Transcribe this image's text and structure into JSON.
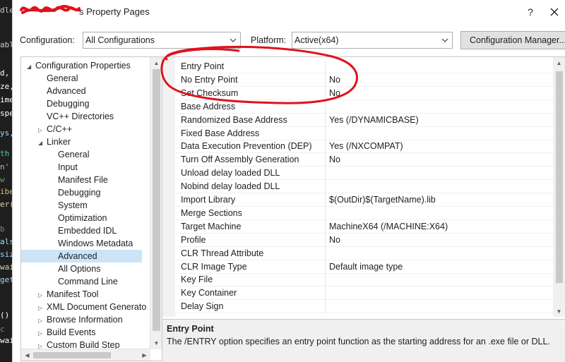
{
  "code_strip": {
    "lines": [
      "dle",
      "abl",
      "d,",
      "ze,",
      "ime",
      "spe",
      "ys,",
      "th",
      "n'",
      "w",
      "ibe",
      "er(",
      "b",
      "als",
      "siz",
      "wai",
      "get",
      "()",
      "c",
      "wai"
    ],
    "color_code": "#dcdcdc"
  },
  "window": {
    "title": "s Property Pages",
    "help_label": "?",
    "close_icon": "close-icon",
    "redaction_color": "#e0121b"
  },
  "toolbar": {
    "configuration_label": "Configuration:",
    "configuration_value": "All Configurations",
    "platform_label": "Platform:",
    "platform_value": "Active(x64)",
    "config_manager_label": "Configuration Manager..."
  },
  "tree": {
    "items": [
      {
        "label": "Configuration Properties",
        "level": 0,
        "expander": "open"
      },
      {
        "label": "General",
        "level": 1,
        "expander": ""
      },
      {
        "label": "Advanced",
        "level": 1,
        "expander": ""
      },
      {
        "label": "Debugging",
        "level": 1,
        "expander": ""
      },
      {
        "label": "VC++ Directories",
        "level": 1,
        "expander": ""
      },
      {
        "label": "C/C++",
        "level": 1,
        "expander": "closed"
      },
      {
        "label": "Linker",
        "level": 1,
        "expander": "open"
      },
      {
        "label": "General",
        "level": 2,
        "expander": ""
      },
      {
        "label": "Input",
        "level": 2,
        "expander": ""
      },
      {
        "label": "Manifest File",
        "level": 2,
        "expander": ""
      },
      {
        "label": "Debugging",
        "level": 2,
        "expander": ""
      },
      {
        "label": "System",
        "level": 2,
        "expander": ""
      },
      {
        "label": "Optimization",
        "level": 2,
        "expander": ""
      },
      {
        "label": "Embedded IDL",
        "level": 2,
        "expander": ""
      },
      {
        "label": "Windows Metadata",
        "level": 2,
        "expander": ""
      },
      {
        "label": "Advanced",
        "level": 2,
        "expander": "",
        "selected": true
      },
      {
        "label": "All Options",
        "level": 2,
        "expander": ""
      },
      {
        "label": "Command Line",
        "level": 2,
        "expander": ""
      },
      {
        "label": "Manifest Tool",
        "level": 1,
        "expander": "closed"
      },
      {
        "label": "XML Document Generato",
        "level": 1,
        "expander": "closed"
      },
      {
        "label": "Browse Information",
        "level": 1,
        "expander": "closed"
      },
      {
        "label": "Build Events",
        "level": 1,
        "expander": "closed"
      },
      {
        "label": "Custom Build Step",
        "level": 1,
        "expander": "closed"
      }
    ]
  },
  "grid": {
    "rows": [
      {
        "name": "Entry Point",
        "value": ""
      },
      {
        "name": "No Entry Point",
        "value": "No"
      },
      {
        "name": "Set Checksum",
        "value": "No"
      },
      {
        "name": "Base Address",
        "value": ""
      },
      {
        "name": "Randomized Base Address",
        "value": "Yes (/DYNAMICBASE)"
      },
      {
        "name": "Fixed Base Address",
        "value": ""
      },
      {
        "name": "Data Execution Prevention (DEP)",
        "value": "Yes (/NXCOMPAT)"
      },
      {
        "name": "Turn Off Assembly Generation",
        "value": "No"
      },
      {
        "name": "Unload delay loaded DLL",
        "value": ""
      },
      {
        "name": "Nobind delay loaded DLL",
        "value": ""
      },
      {
        "name": "Import Library",
        "value": "$(OutDir)$(TargetName).lib"
      },
      {
        "name": "Merge Sections",
        "value": ""
      },
      {
        "name": "Target Machine",
        "value": "MachineX64 (/MACHINE:X64)"
      },
      {
        "name": "Profile",
        "value": "No"
      },
      {
        "name": "CLR Thread Attribute",
        "value": ""
      },
      {
        "name": "CLR Image Type",
        "value": "Default image type"
      },
      {
        "name": "Key File",
        "value": ""
      },
      {
        "name": "Key Container",
        "value": ""
      },
      {
        "name": "Delay Sign",
        "value": ""
      }
    ]
  },
  "description": {
    "title": "Entry Point",
    "text": "The /ENTRY option specifies an entry point function as the starting address for an .exe file or DLL."
  },
  "annotation": {
    "color": "#e0121b"
  },
  "icons": {
    "combo_arrow": "chevron-down-icon",
    "expander_open": "tree-expanded-icon",
    "expander_closed": "tree-collapsed-icon"
  }
}
